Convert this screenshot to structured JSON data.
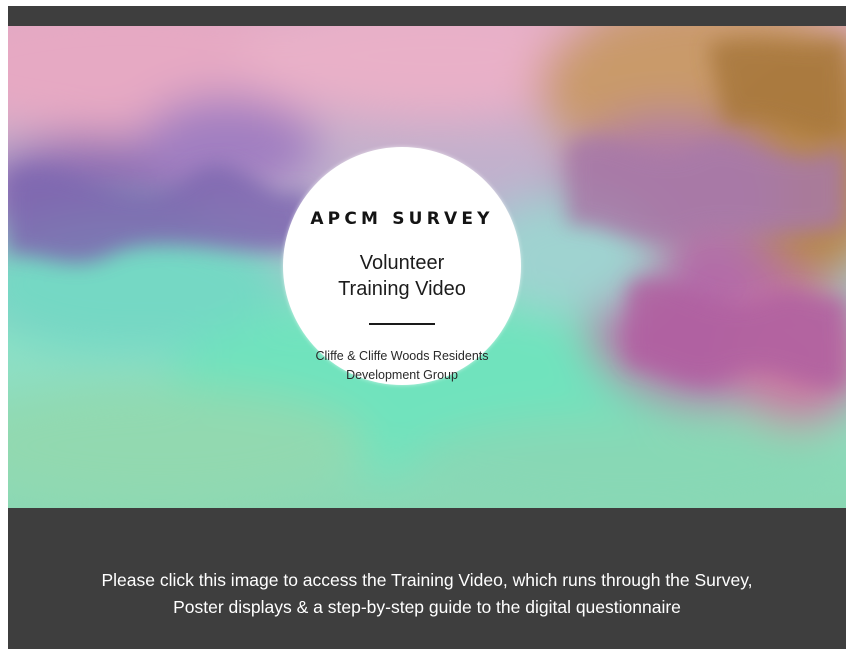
{
  "video": {
    "title": "APCM SURVEY",
    "subtitle_line1": "Volunteer",
    "subtitle_line2": "Training Video",
    "org_line1": "Cliffe & Cliffe Woods Residents",
    "org_line2": "Development Group"
  },
  "caption": {
    "line1": "Please click this image to access the Training Video, which runs through the Survey,",
    "line2": "Poster displays & a step-by-step guide to the digital questionnaire"
  },
  "colors": {
    "frame": "#3e3e3e",
    "caption_text": "#ffffff",
    "circle": "#ffffff",
    "teal": "#6fe3bd",
    "magenta": "#b36aa8",
    "amber": "#c08a3a"
  }
}
